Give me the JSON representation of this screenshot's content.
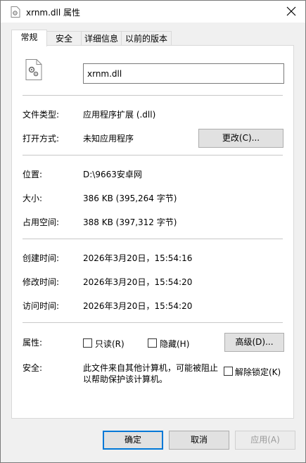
{
  "window": {
    "title": "xrnm.dll 属性",
    "close_glyph": "✕"
  },
  "tabs": [
    {
      "label": "常规",
      "active": true
    },
    {
      "label": "安全",
      "active": false
    },
    {
      "label": "详细信息",
      "active": false
    },
    {
      "label": "以前的版本",
      "active": false
    }
  ],
  "general": {
    "file_name": "xrnm.dll",
    "type_label": "文件类型:",
    "type_value": "应用程序扩展 (.dll)",
    "opens_with_label": "打开方式:",
    "opens_with_value": "未知应用程序",
    "change_button": "更改(C)...",
    "location_label": "位置:",
    "location_value": "D:\\9663安卓网",
    "size_label": "大小:",
    "size_value": "386 KB (395,264 字节)",
    "size_on_disk_label": "占用空间:",
    "size_on_disk_value": "388 KB (397,312 字节)",
    "created_label": "创建时间:",
    "created_value": "2026年3月20日，15:54:16",
    "modified_label": "修改时间:",
    "modified_value": "2026年3月20日，15:54:20",
    "accessed_label": "访问时间:",
    "accessed_value": "2026年3月20日，15:54:20",
    "attributes_label": "属性:",
    "readonly_label": "只读(R)",
    "readonly_checked": false,
    "hidden_label": "隐藏(H)",
    "hidden_checked": false,
    "advanced_button": "高级(D)...",
    "security_label": "安全:",
    "security_text_line1": "此文件来自其他计算机，可能被阻止",
    "security_text_line2": "以帮助保护该计算机。",
    "unblock_label": "解除锁定(K)",
    "unblock_checked": false
  },
  "footer": {
    "ok": "确定",
    "cancel": "取消",
    "apply": "应用(A)",
    "apply_disabled": true
  },
  "colors": {
    "accent": "#0078d7",
    "window_bg": "#f0f0f0",
    "panel_bg": "#ffffff"
  }
}
